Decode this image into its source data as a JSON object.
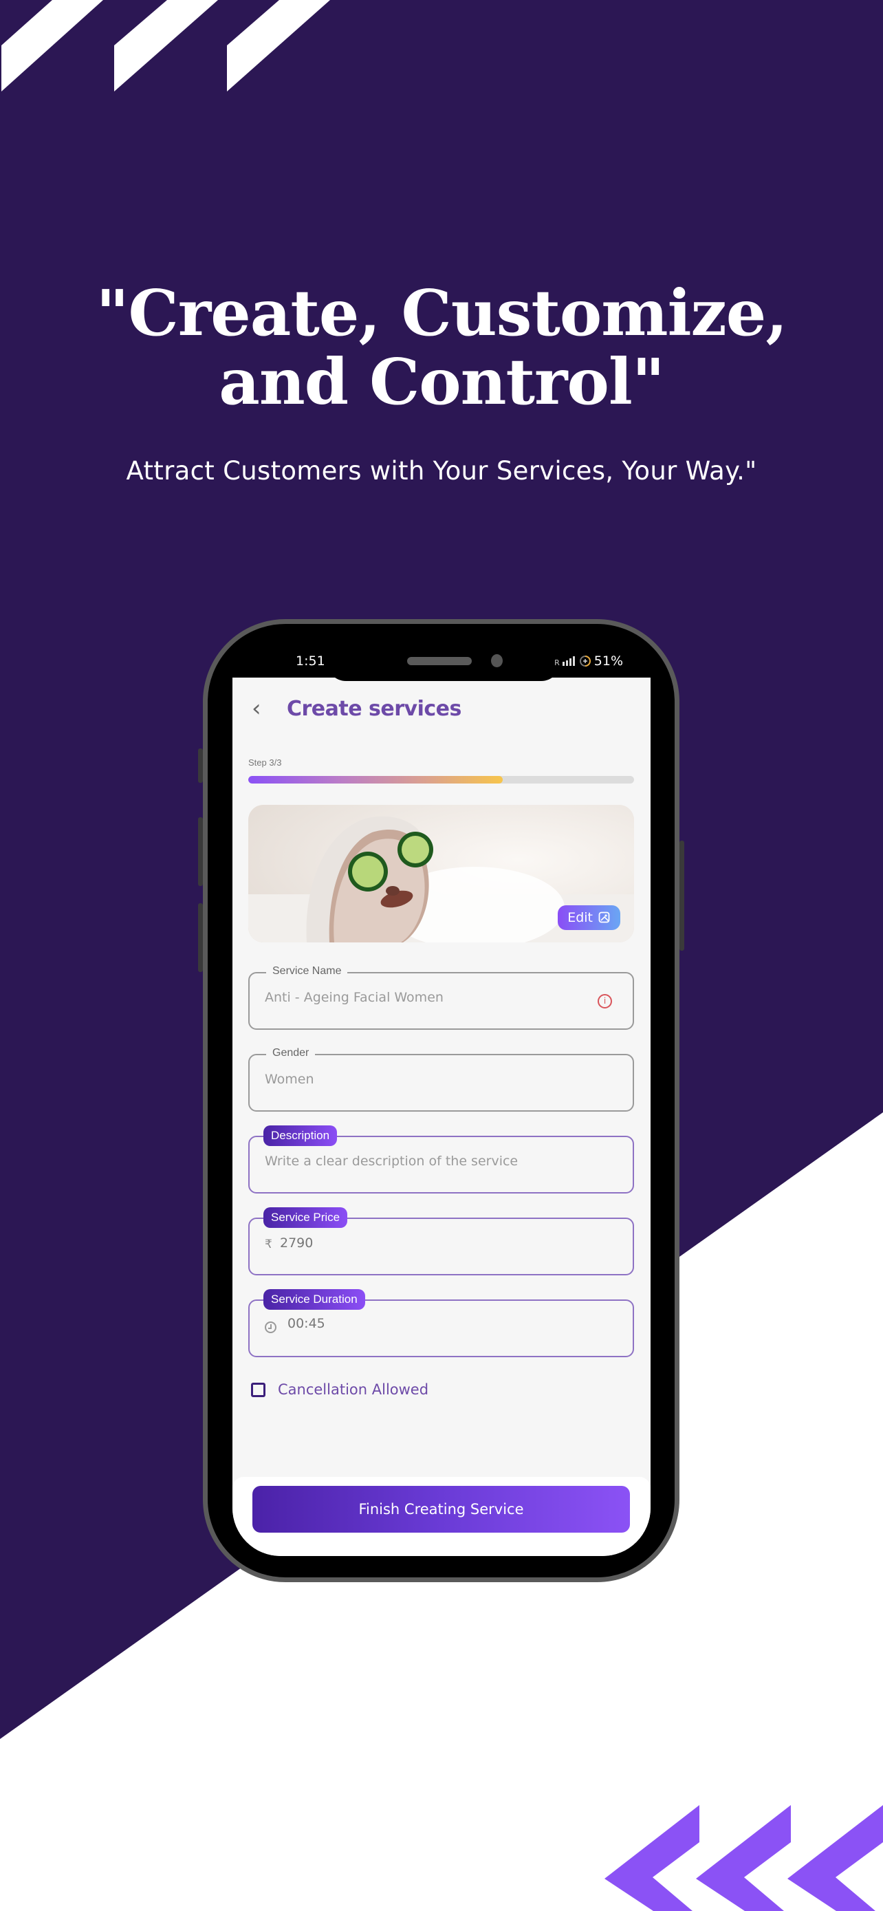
{
  "colors": {
    "background": "#2c1754",
    "accent": "#8b52f5",
    "title_purple": "#6d4aa8",
    "error_red": "#d9545a",
    "white": "#ffffff"
  },
  "marketing": {
    "headline_line1": "\"Create, Customize,",
    "headline_line2": "and Control\"",
    "subheadline": "Attract Customers with Your Services, Your Way.\""
  },
  "status_bar": {
    "time": "1:51",
    "network": "R",
    "battery": "51%"
  },
  "app": {
    "title": "Create services",
    "back_icon": "chevron-left-icon",
    "step_label": "Step 3/3",
    "progress_fraction": 0.66,
    "hero_image": {
      "description": "woman with facial mask and cucumber slices",
      "edit_label": "Edit",
      "edit_icon": "image-edit-icon"
    },
    "fields": {
      "service_name": {
        "label": "Service Name",
        "value": "Anti - Ageing Facial Women",
        "icon": "info-icon"
      },
      "gender": {
        "label": "Gender",
        "value": "Women"
      },
      "description": {
        "label": "Description",
        "placeholder": "Write a clear description of the service"
      },
      "service_price": {
        "label": "Service Price",
        "currency": "₹",
        "value": "2790"
      },
      "service_duration": {
        "label": "Service Duration",
        "icon": "clock-icon",
        "value": "00:45"
      }
    },
    "cancellation": {
      "label": "Cancellation Allowed",
      "checked": false
    },
    "finish_button": "Finish Creating Service"
  }
}
